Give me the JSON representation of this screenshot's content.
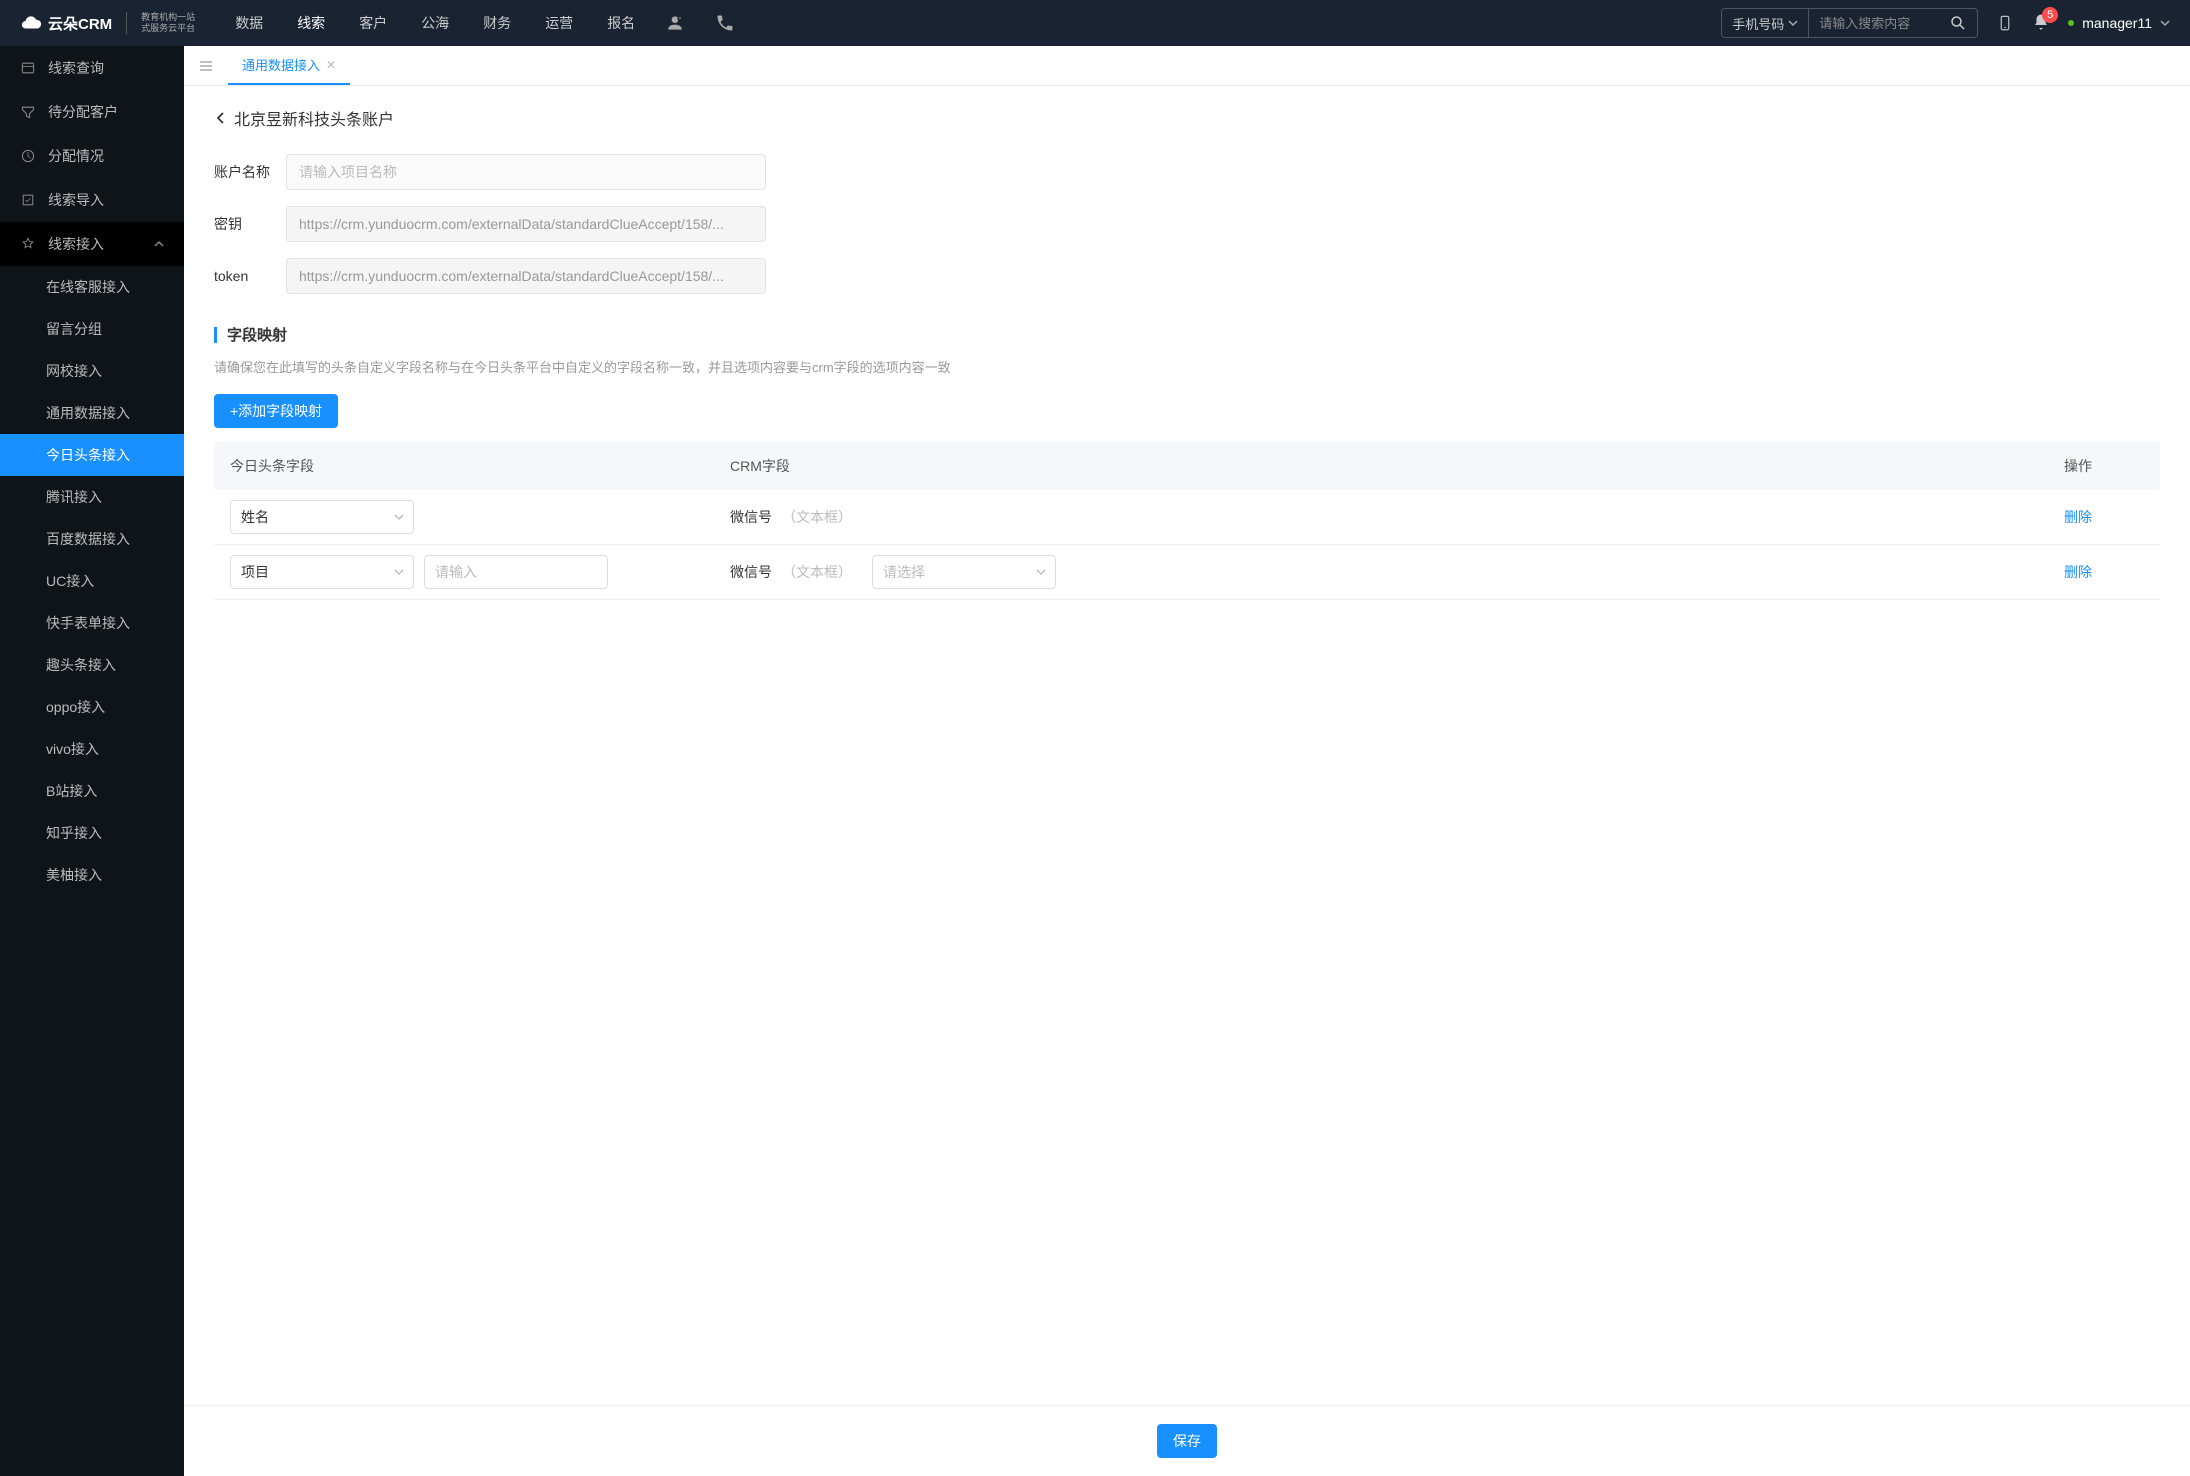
{
  "header": {
    "logo_text": "云朵CRM",
    "logo_sub1": "教育机构一站",
    "logo_sub2": "式服务云平台",
    "nav": [
      "数据",
      "线索",
      "客户",
      "公海",
      "财务",
      "运营",
      "报名"
    ],
    "nav_active": 1,
    "search_type": "手机号码",
    "search_placeholder": "请输入搜索内容",
    "notif_count": "5",
    "username": "manager11"
  },
  "sidebar": {
    "items": [
      {
        "label": "线索查询"
      },
      {
        "label": "待分配客户"
      },
      {
        "label": "分配情况"
      },
      {
        "label": "线索导入"
      },
      {
        "label": "线索接入",
        "open": true,
        "children": [
          {
            "label": "在线客服接入"
          },
          {
            "label": "留言分组"
          },
          {
            "label": "网校接入"
          },
          {
            "label": "通用数据接入"
          },
          {
            "label": "今日头条接入",
            "active": true
          },
          {
            "label": "腾讯接入"
          },
          {
            "label": "百度数据接入"
          },
          {
            "label": "UC接入"
          },
          {
            "label": "快手表单接入"
          },
          {
            "label": "趣头条接入"
          },
          {
            "label": "oppo接入"
          },
          {
            "label": "vivo接入"
          },
          {
            "label": "B站接入"
          },
          {
            "label": "知乎接入"
          },
          {
            "label": "美柚接入"
          }
        ]
      }
    ]
  },
  "tabs": {
    "active": "通用数据接入"
  },
  "page": {
    "breadcrumb": "北京昱新科技头条账户",
    "form": {
      "account_label": "账户名称",
      "account_placeholder": "请输入项目名称",
      "secret_label": "密钥",
      "secret_value": "https://crm.yunduocrm.com/externalData/standardClueAccept/158/...",
      "token_label": "token",
      "token_value": "https://crm.yunduocrm.com/externalData/standardClueAccept/158/..."
    },
    "section": {
      "title": "字段映射",
      "hint": "请确保您在此填写的头条自定义字段名称与在今日头条平台中自定义的字段名称一致，并且选项内容要与crm字段的选项内容一致",
      "add_btn": "+添加字段映射"
    },
    "table": {
      "headers": [
        "今日头条字段",
        "CRM字段",
        "操作"
      ],
      "rows": [
        {
          "toutiao_select": "姓名",
          "extra_input_placeholder": "",
          "crm_label": "微信号",
          "crm_hint": "（文本框）",
          "crm_select_placeholder": "",
          "action": "删除"
        },
        {
          "toutiao_select": "项目",
          "extra_input_placeholder": "请输入",
          "crm_label": "微信号",
          "crm_hint": "（文本框）",
          "crm_select_placeholder": "请选择",
          "action": "删除"
        }
      ]
    },
    "save_btn": "保存"
  }
}
